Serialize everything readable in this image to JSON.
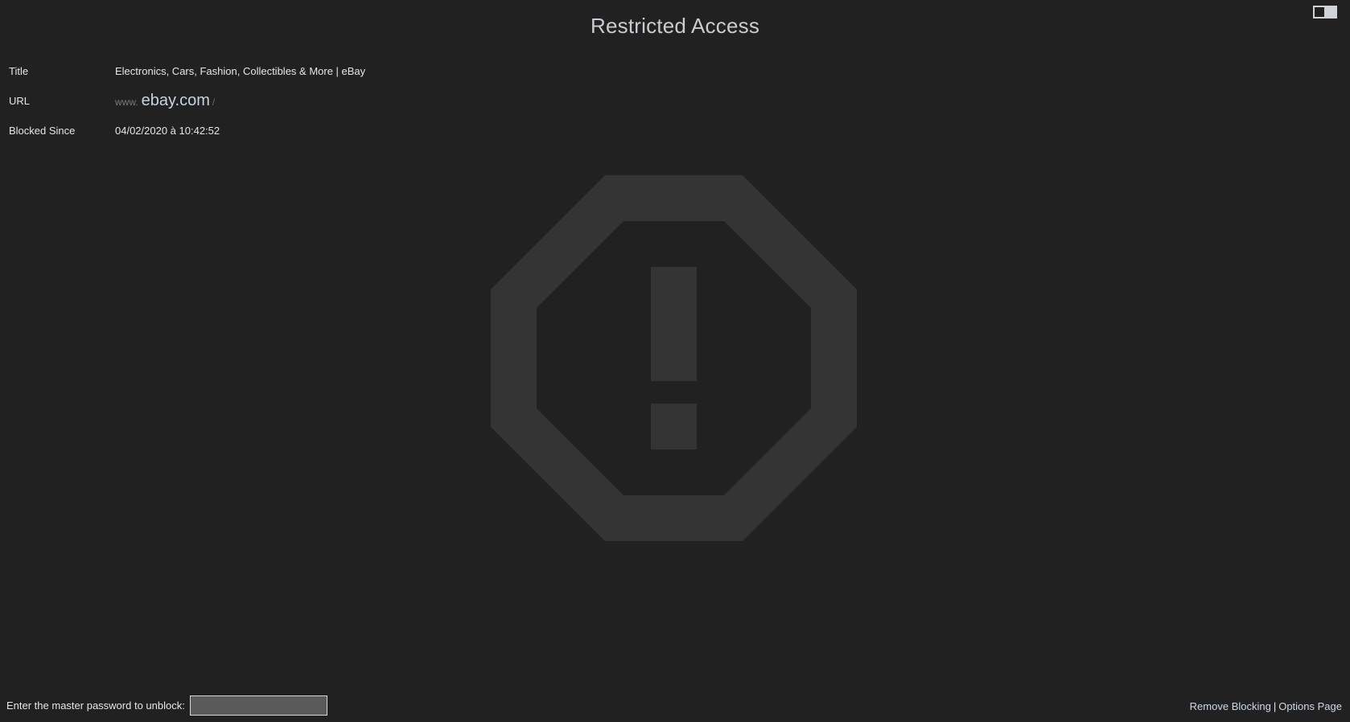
{
  "header": {
    "title": "Restricted Access",
    "toggle_icon": "dark-mode-toggle-icon"
  },
  "info": {
    "title_label": "Title",
    "title_value": "Electronics, Cars, Fashion, Collectibles & More | eBay",
    "url_label": "URL",
    "url_prefix": "www.",
    "url_domain": "ebay.com",
    "url_suffix": "/",
    "blocked_label": "Blocked Since",
    "blocked_value": "04/02/2020 à 10:42:52"
  },
  "icon": {
    "name": "warning-octagon-icon",
    "color": "#343434"
  },
  "footer": {
    "password_prompt": "Enter the master password to unblock:",
    "password_value": "",
    "remove_label": "Remove Blocking",
    "separator": "|",
    "options_label": "Options Page"
  }
}
